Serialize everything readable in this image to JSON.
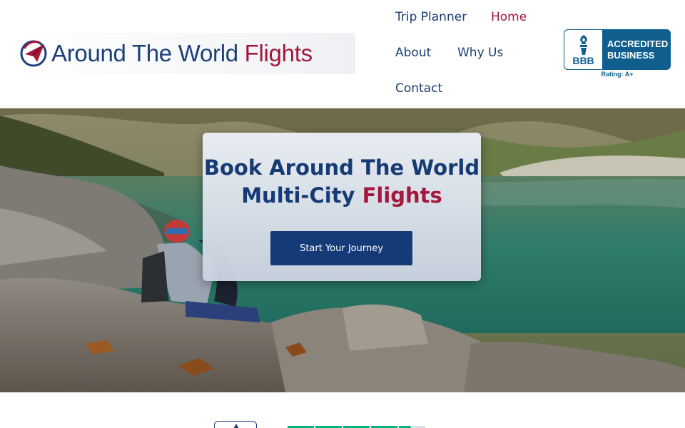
{
  "header": {
    "logo": {
      "text_main": "Around The World",
      "text_accent": "Flights",
      "icon": "paper-plane-globe-icon"
    },
    "nav": [
      {
        "label": "Trip Planner",
        "active": false
      },
      {
        "label": "Home",
        "active": true
      },
      {
        "label": "About",
        "active": false
      },
      {
        "label": "Why Us",
        "active": false
      },
      {
        "label": "Contact",
        "active": false
      }
    ],
    "bbb": {
      "abbr": "BBB",
      "line1": "ACCREDITED",
      "line2": "BUSINESS",
      "rating": "Rating: A+"
    }
  },
  "hero": {
    "title_line1": "Book Around The World",
    "title_line2_main": "Multi-City",
    "title_line2_accent": "Flights",
    "cta_label": "Start Your Journey"
  },
  "below": {
    "rating_fill": 0.9
  },
  "colors": {
    "brand_navy": "#1c3e74",
    "brand_red": "#a3183d",
    "cta_bg": "#153a78",
    "bbb_blue": "#0f5e8d",
    "trustpilot_green": "#00b67a"
  }
}
